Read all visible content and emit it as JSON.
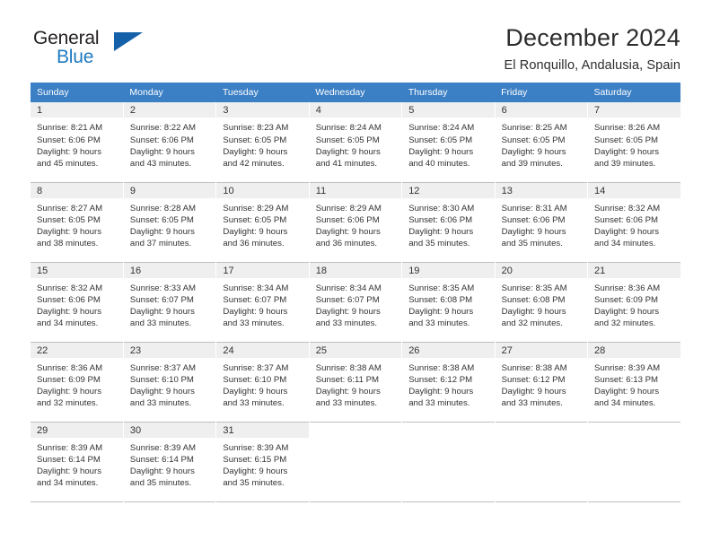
{
  "brand": {
    "name_top": "General",
    "name_bottom": "Blue",
    "triangle_color": "#1561a9",
    "accent_color": "#1f7ac0"
  },
  "header": {
    "title": "December 2024",
    "location": "El Ronquillo, Andalusia, Spain"
  },
  "calendar": {
    "header_bg": "#3b7fc4",
    "daynum_bg": "#efefef",
    "weekdays": [
      "Sunday",
      "Monday",
      "Tuesday",
      "Wednesday",
      "Thursday",
      "Friday",
      "Saturday"
    ],
    "weeks": [
      [
        {
          "day": "1",
          "sunrise": "Sunrise: 8:21 AM",
          "sunset": "Sunset: 6:06 PM",
          "daylight_1": "Daylight: 9 hours",
          "daylight_2": "and 45 minutes."
        },
        {
          "day": "2",
          "sunrise": "Sunrise: 8:22 AM",
          "sunset": "Sunset: 6:06 PM",
          "daylight_1": "Daylight: 9 hours",
          "daylight_2": "and 43 minutes."
        },
        {
          "day": "3",
          "sunrise": "Sunrise: 8:23 AM",
          "sunset": "Sunset: 6:05 PM",
          "daylight_1": "Daylight: 9 hours",
          "daylight_2": "and 42 minutes."
        },
        {
          "day": "4",
          "sunrise": "Sunrise: 8:24 AM",
          "sunset": "Sunset: 6:05 PM",
          "daylight_1": "Daylight: 9 hours",
          "daylight_2": "and 41 minutes."
        },
        {
          "day": "5",
          "sunrise": "Sunrise: 8:24 AM",
          "sunset": "Sunset: 6:05 PM",
          "daylight_1": "Daylight: 9 hours",
          "daylight_2": "and 40 minutes."
        },
        {
          "day": "6",
          "sunrise": "Sunrise: 8:25 AM",
          "sunset": "Sunset: 6:05 PM",
          "daylight_1": "Daylight: 9 hours",
          "daylight_2": "and 39 minutes."
        },
        {
          "day": "7",
          "sunrise": "Sunrise: 8:26 AM",
          "sunset": "Sunset: 6:05 PM",
          "daylight_1": "Daylight: 9 hours",
          "daylight_2": "and 39 minutes."
        }
      ],
      [
        {
          "day": "8",
          "sunrise": "Sunrise: 8:27 AM",
          "sunset": "Sunset: 6:05 PM",
          "daylight_1": "Daylight: 9 hours",
          "daylight_2": "and 38 minutes."
        },
        {
          "day": "9",
          "sunrise": "Sunrise: 8:28 AM",
          "sunset": "Sunset: 6:05 PM",
          "daylight_1": "Daylight: 9 hours",
          "daylight_2": "and 37 minutes."
        },
        {
          "day": "10",
          "sunrise": "Sunrise: 8:29 AM",
          "sunset": "Sunset: 6:05 PM",
          "daylight_1": "Daylight: 9 hours",
          "daylight_2": "and 36 minutes."
        },
        {
          "day": "11",
          "sunrise": "Sunrise: 8:29 AM",
          "sunset": "Sunset: 6:06 PM",
          "daylight_1": "Daylight: 9 hours",
          "daylight_2": "and 36 minutes."
        },
        {
          "day": "12",
          "sunrise": "Sunrise: 8:30 AM",
          "sunset": "Sunset: 6:06 PM",
          "daylight_1": "Daylight: 9 hours",
          "daylight_2": "and 35 minutes."
        },
        {
          "day": "13",
          "sunrise": "Sunrise: 8:31 AM",
          "sunset": "Sunset: 6:06 PM",
          "daylight_1": "Daylight: 9 hours",
          "daylight_2": "and 35 minutes."
        },
        {
          "day": "14",
          "sunrise": "Sunrise: 8:32 AM",
          "sunset": "Sunset: 6:06 PM",
          "daylight_1": "Daylight: 9 hours",
          "daylight_2": "and 34 minutes."
        }
      ],
      [
        {
          "day": "15",
          "sunrise": "Sunrise: 8:32 AM",
          "sunset": "Sunset: 6:06 PM",
          "daylight_1": "Daylight: 9 hours",
          "daylight_2": "and 34 minutes."
        },
        {
          "day": "16",
          "sunrise": "Sunrise: 8:33 AM",
          "sunset": "Sunset: 6:07 PM",
          "daylight_1": "Daylight: 9 hours",
          "daylight_2": "and 33 minutes."
        },
        {
          "day": "17",
          "sunrise": "Sunrise: 8:34 AM",
          "sunset": "Sunset: 6:07 PM",
          "daylight_1": "Daylight: 9 hours",
          "daylight_2": "and 33 minutes."
        },
        {
          "day": "18",
          "sunrise": "Sunrise: 8:34 AM",
          "sunset": "Sunset: 6:07 PM",
          "daylight_1": "Daylight: 9 hours",
          "daylight_2": "and 33 minutes."
        },
        {
          "day": "19",
          "sunrise": "Sunrise: 8:35 AM",
          "sunset": "Sunset: 6:08 PM",
          "daylight_1": "Daylight: 9 hours",
          "daylight_2": "and 33 minutes."
        },
        {
          "day": "20",
          "sunrise": "Sunrise: 8:35 AM",
          "sunset": "Sunset: 6:08 PM",
          "daylight_1": "Daylight: 9 hours",
          "daylight_2": "and 32 minutes."
        },
        {
          "day": "21",
          "sunrise": "Sunrise: 8:36 AM",
          "sunset": "Sunset: 6:09 PM",
          "daylight_1": "Daylight: 9 hours",
          "daylight_2": "and 32 minutes."
        }
      ],
      [
        {
          "day": "22",
          "sunrise": "Sunrise: 8:36 AM",
          "sunset": "Sunset: 6:09 PM",
          "daylight_1": "Daylight: 9 hours",
          "daylight_2": "and 32 minutes."
        },
        {
          "day": "23",
          "sunrise": "Sunrise: 8:37 AM",
          "sunset": "Sunset: 6:10 PM",
          "daylight_1": "Daylight: 9 hours",
          "daylight_2": "and 33 minutes."
        },
        {
          "day": "24",
          "sunrise": "Sunrise: 8:37 AM",
          "sunset": "Sunset: 6:10 PM",
          "daylight_1": "Daylight: 9 hours",
          "daylight_2": "and 33 minutes."
        },
        {
          "day": "25",
          "sunrise": "Sunrise: 8:38 AM",
          "sunset": "Sunset: 6:11 PM",
          "daylight_1": "Daylight: 9 hours",
          "daylight_2": "and 33 minutes."
        },
        {
          "day": "26",
          "sunrise": "Sunrise: 8:38 AM",
          "sunset": "Sunset: 6:12 PM",
          "daylight_1": "Daylight: 9 hours",
          "daylight_2": "and 33 minutes."
        },
        {
          "day": "27",
          "sunrise": "Sunrise: 8:38 AM",
          "sunset": "Sunset: 6:12 PM",
          "daylight_1": "Daylight: 9 hours",
          "daylight_2": "and 33 minutes."
        },
        {
          "day": "28",
          "sunrise": "Sunrise: 8:39 AM",
          "sunset": "Sunset: 6:13 PM",
          "daylight_1": "Daylight: 9 hours",
          "daylight_2": "and 34 minutes."
        }
      ],
      [
        {
          "day": "29",
          "sunrise": "Sunrise: 8:39 AM",
          "sunset": "Sunset: 6:14 PM",
          "daylight_1": "Daylight: 9 hours",
          "daylight_2": "and 34 minutes."
        },
        {
          "day": "30",
          "sunrise": "Sunrise: 8:39 AM",
          "sunset": "Sunset: 6:14 PM",
          "daylight_1": "Daylight: 9 hours",
          "daylight_2": "and 35 minutes."
        },
        {
          "day": "31",
          "sunrise": "Sunrise: 8:39 AM",
          "sunset": "Sunset: 6:15 PM",
          "daylight_1": "Daylight: 9 hours",
          "daylight_2": "and 35 minutes."
        },
        {
          "day": "",
          "sunrise": "",
          "sunset": "",
          "daylight_1": "",
          "daylight_2": ""
        },
        {
          "day": "",
          "sunrise": "",
          "sunset": "",
          "daylight_1": "",
          "daylight_2": ""
        },
        {
          "day": "",
          "sunrise": "",
          "sunset": "",
          "daylight_1": "",
          "daylight_2": ""
        },
        {
          "day": "",
          "sunrise": "",
          "sunset": "",
          "daylight_1": "",
          "daylight_2": ""
        }
      ]
    ]
  }
}
